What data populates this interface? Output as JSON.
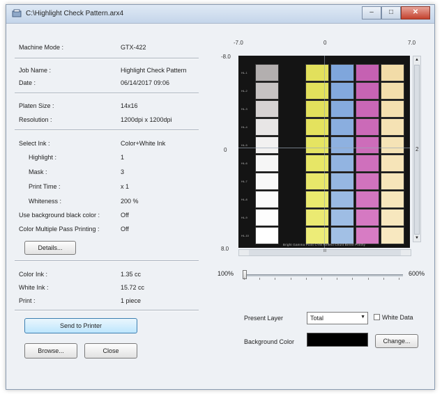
{
  "window": {
    "title": "C:\\Highlight Check Pattern.arx4"
  },
  "info": {
    "machine_mode": {
      "label": "Machine Mode :",
      "value": "GTX-422"
    },
    "job_name": {
      "label": "Job Name :",
      "value": "Highlight Check Pattern"
    },
    "date": {
      "label": "Date :",
      "value": "06/14/2017 09:06"
    },
    "platen_size": {
      "label": "Platen Size :",
      "value": "14x16"
    },
    "resolution": {
      "label": "Resolution :",
      "value": "1200dpi x 1200dpi"
    },
    "select_ink": {
      "label": "Select Ink :",
      "value": "Color+White Ink"
    },
    "highlight": {
      "label": "Highlight :",
      "value": "1"
    },
    "mask": {
      "label": "Mask :",
      "value": "3"
    },
    "print_time": {
      "label": "Print Time :",
      "value": "x 1"
    },
    "whiteness": {
      "label": "Whiteness :",
      "value": "200 %"
    },
    "bg_black": {
      "label": "Use background black color :",
      "value": "Off"
    },
    "multi_pass": {
      "label": "Color Multiple Pass Printing :",
      "value": "Off"
    },
    "color_ink": {
      "label": "Color Ink :",
      "value": "1.35 cc"
    },
    "white_ink": {
      "label": "White Ink :",
      "value": "15.72 cc"
    },
    "print": {
      "label": "Print :",
      "value": "1 piece"
    }
  },
  "buttons": {
    "details": "Details...",
    "send": "Send to Printer",
    "browse": "Browse...",
    "close": "Close",
    "change": "Change..."
  },
  "axis": {
    "x_left": "-7.0",
    "x_mid": "0",
    "x_right": "7.0",
    "y_top": "-8.0",
    "y_mid": "0",
    "y_bottom": "8.0",
    "right_mid": "2"
  },
  "zoom": {
    "min": "100%",
    "max": "600%",
    "value_fraction": 0.0
  },
  "hscroll_label": "III",
  "preview": {
    "row_labels": [
      "HL-1",
      "HL-2",
      "HL-3",
      "HL-4",
      "HL-5",
      "HL-6",
      "HL-7",
      "HL-8",
      "HL-9",
      "HL-10"
    ],
    "bottom_labels": "Bright Gamma Point CYM Reflect Chunt Bereit Plinthy",
    "columns": [
      {
        "colors": [
          "#b3afaf",
          "#c7c3c3",
          "#d6d2d2",
          "#e8e6e6",
          "#f2f1f1",
          "#f6f6f6",
          "#f9f9f9",
          "#fbfbfb",
          "#fdfdfd",
          "#ffffff"
        ]
      },
      {
        "colors": [
          "#e2e05c",
          "#e2e05c",
          "#e2e05c",
          "#e4e25e",
          "#e5e462",
          "#e7e666",
          "#e8e76a",
          "#eae96e",
          "#ebea72",
          "#edec78"
        ]
      },
      {
        "colors": [
          "#7fa6dc",
          "#83a9dd",
          "#86abde",
          "#8aaedf",
          "#8eb1e0",
          "#92b4e1",
          "#96b7e2",
          "#9abae3",
          "#9ebde4",
          "#a2c0e5"
        ]
      },
      {
        "colors": [
          "#c561b2",
          "#c764b4",
          "#c967b6",
          "#cb6ab8",
          "#cd6dba",
          "#cf70bc",
          "#d173be",
          "#d376c0",
          "#d579c2",
          "#d77cc4"
        ]
      },
      {
        "colors": [
          "#f2dca8",
          "#f3deac",
          "#f4e0b0",
          "#f5e2b4",
          "#f5e3b6",
          "#f6e4b8",
          "#f6e5ba",
          "#f7e6bc",
          "#f7e7be",
          "#f8e8c0"
        ]
      }
    ]
  },
  "layer": {
    "label": "Present Layer",
    "selected": "Total",
    "white_data_label": "White Data",
    "white_data_checked": false,
    "bg_color_label": "Background Color",
    "bg_color": "#000000"
  }
}
